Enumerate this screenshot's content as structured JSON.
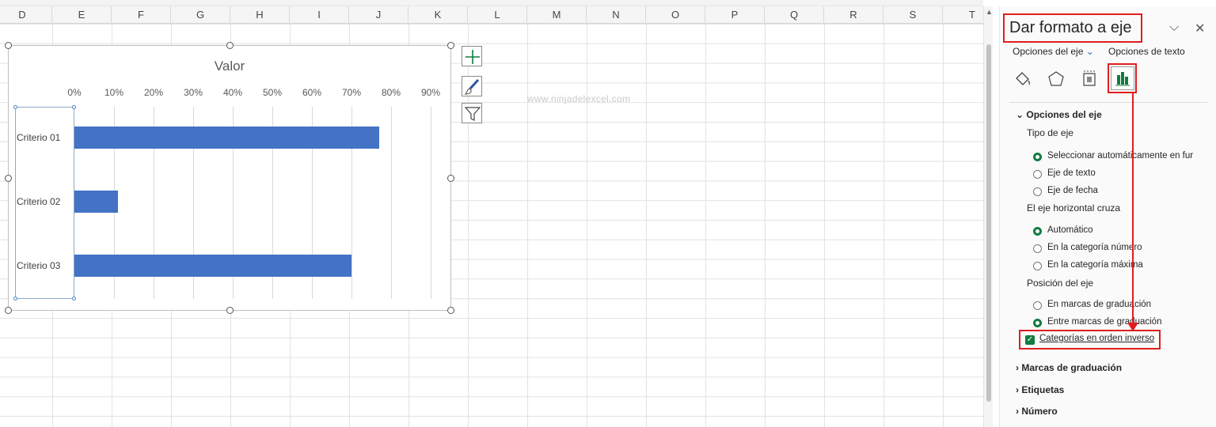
{
  "columns": [
    "D",
    "E",
    "F",
    "G",
    "H",
    "I",
    "J",
    "K",
    "L",
    "M",
    "N",
    "O",
    "P",
    "Q",
    "R",
    "S",
    "T"
  ],
  "watermark": "www.ninjadelexcel.com",
  "chart_data": {
    "type": "bar",
    "orientation": "horizontal",
    "title": "Valor",
    "categories": [
      "Criterio 01",
      "Criterio 02",
      "Criterio 03"
    ],
    "values": [
      0.77,
      0.11,
      0.7
    ],
    "xlim": [
      0,
      0.9
    ],
    "tick_labels": [
      "0%",
      "10%",
      "20%",
      "30%",
      "40%",
      "50%",
      "60%",
      "70%",
      "80%",
      "90%"
    ],
    "grid": true,
    "bar_color": "#4472c4"
  },
  "pane": {
    "title": "Dar formato a eje",
    "tab_axis": "Opciones del eje",
    "tab_text": "Opciones de texto",
    "sections": {
      "axis_options": "Opciones del eje",
      "ticks": "Marcas de graduación",
      "labels": "Etiquetas",
      "number": "Número"
    },
    "axis_type": {
      "label": "Tipo de eje",
      "options": [
        "Seleccionar automáticamente en fur",
        "Eje de texto",
        "Eje de fecha"
      ]
    },
    "crosses": {
      "label": "El eje horizontal cruza",
      "options": [
        "Automático",
        "En la categoría número",
        "En la categoría máxima"
      ]
    },
    "position": {
      "label": "Posición del eje",
      "options": [
        "En marcas de graduación",
        "Entre marcas de graduación"
      ]
    },
    "reverse_label": "Categorías en orden inverso",
    "accent_color": "#107c41",
    "highlight_color": "#e01e1e"
  }
}
